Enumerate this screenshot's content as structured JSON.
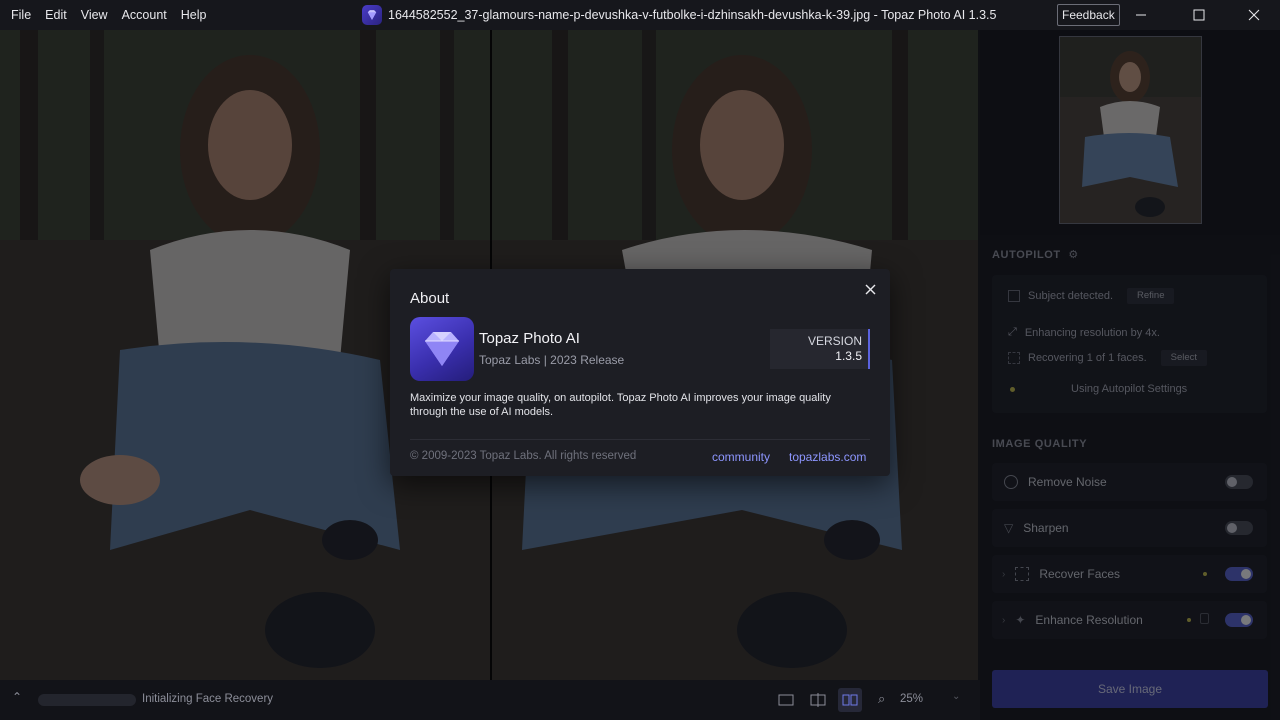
{
  "menu": [
    "File",
    "Edit",
    "View",
    "Account",
    "Help"
  ],
  "window": {
    "title": "1644582552_37-glamours-name-p-devushka-v-futbolke-i-dzhinsakh-devushka-k-39.jpg - Topaz Photo AI 1.3.5",
    "feedback_label": "Feedback"
  },
  "about": {
    "title": "About",
    "product_name": "Topaz Photo AI",
    "product_sub": "Topaz Labs | 2023 Release",
    "version_label": "VERSION",
    "version": "1.3.5",
    "description": "Maximize your image quality, on autopilot. Topaz Photo AI improves your image quality through the use of AI models.",
    "copyright": "© 2009-2023 Topaz Labs. All rights reserved",
    "links": [
      "community",
      "topazlabs.com"
    ]
  },
  "autopilot": {
    "title": "AUTOPILOT",
    "subject": "Subject detected.",
    "refine": "Refine",
    "enhancing": "Enhancing resolution by 4x.",
    "recovering": "Recovering 1 of 1 faces.",
    "select": "Select",
    "settings": "Using Autopilot Settings"
  },
  "image_quality": {
    "title": "IMAGE QUALITY",
    "rows": [
      {
        "label": "Remove Noise",
        "on": false
      },
      {
        "label": "Sharpen",
        "on": false
      },
      {
        "label": "Recover Faces",
        "on": true
      },
      {
        "label": "Enhance Resolution",
        "on": true
      }
    ]
  },
  "save_label": "Save Image",
  "status": {
    "text": "Initializing Face Recovery",
    "progress": 0.0
  },
  "zoom": "25%",
  "colors": {
    "accent": "#5b63e0",
    "link": "#8d96ff",
    "save": "#3b3fa8"
  }
}
